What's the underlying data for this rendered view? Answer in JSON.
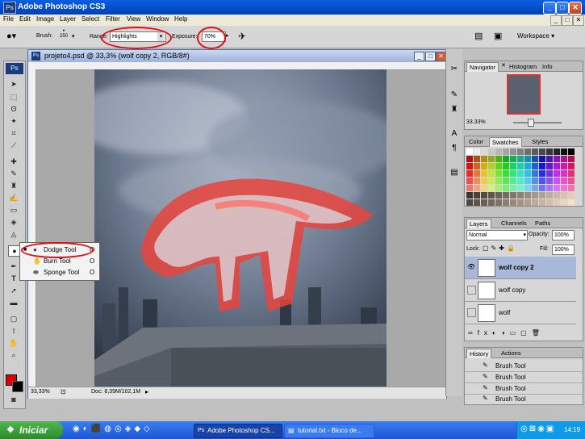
{
  "app": {
    "title": "Adobe Photoshop CS3",
    "logo": "Ps"
  },
  "menu": [
    "File",
    "Edit",
    "Image",
    "Layer",
    "Select",
    "Filter",
    "View",
    "Window",
    "Help"
  ],
  "options": {
    "brush_label": "Brush:",
    "brush_size": "250",
    "range_label": "Range:",
    "range_value": "Highlights",
    "exposure_label": "Exposure:",
    "exposure_value": "70%",
    "workspace_label": "Workspace"
  },
  "document": {
    "title": "projeto4.psd @ 33,3% (wolf copy 2, RGB/8#)",
    "zoom": "33,33%",
    "doc_size": "Doc: 8,39M/102,1M"
  },
  "flyout": {
    "items": [
      {
        "label": "Dodge Tool",
        "key": "O",
        "selected": true
      },
      {
        "label": "Burn Tool",
        "key": "O",
        "selected": false
      },
      {
        "label": "Sponge Tool",
        "key": "O",
        "selected": false
      }
    ]
  },
  "navigator": {
    "tabs": [
      "Navigator",
      "Histogram",
      "Info"
    ],
    "zoom": "33.33%"
  },
  "swatches": {
    "tabs": [
      "Color",
      "Swatches",
      "Styles"
    ]
  },
  "layers": {
    "tabs": [
      "Layers",
      "Channels",
      "Paths"
    ],
    "blend_mode": "Normal",
    "opacity_label": "Opacity:",
    "opacity_value": "100%",
    "lock_label": "Lock:",
    "fill_label": "Fill:",
    "fill_value": "100%",
    "items": [
      {
        "name": "wolf copy 2",
        "visible": true,
        "selected": true
      },
      {
        "name": "wolf copy",
        "visible": false,
        "selected": false
      },
      {
        "name": "wolf",
        "visible": false,
        "selected": false
      }
    ]
  },
  "history": {
    "tabs": [
      "History",
      "Actions"
    ],
    "items": [
      "Brush Tool",
      "Brush Tool",
      "Brush Tool",
      "Brush Tool"
    ]
  },
  "taskbar": {
    "start": "Iniciar",
    "windows": [
      "Adobe Photoshop CS...",
      "tutorial.txt - Bloco de..."
    ],
    "clock": "14:19"
  },
  "colors": {
    "foreground": "#e00000",
    "background": "#000000",
    "annotation": "#e01010"
  }
}
